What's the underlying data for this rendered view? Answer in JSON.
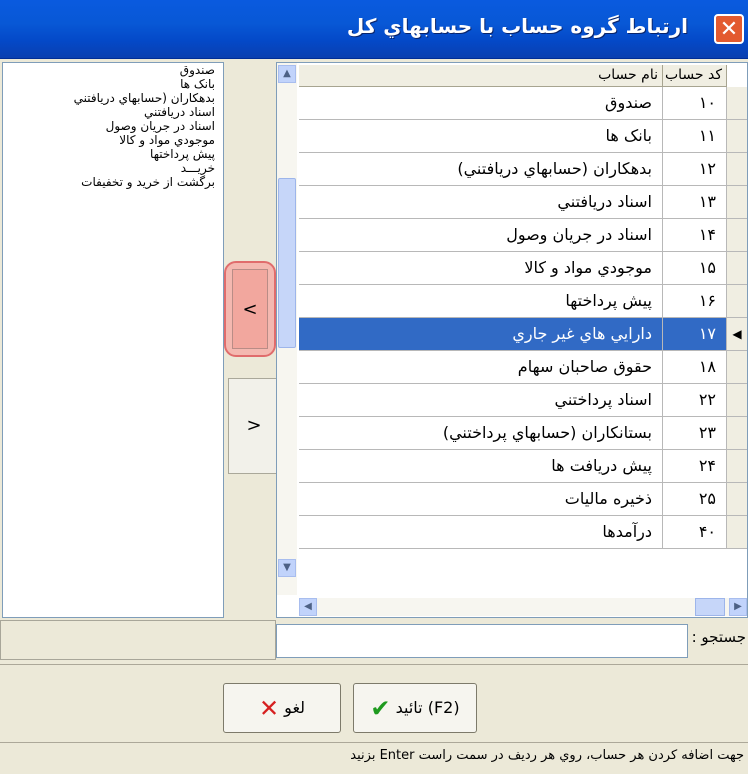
{
  "window": {
    "title": "ارتباط گروه حساب با حسابهاي کل",
    "close_glyph": "✕"
  },
  "left_list": {
    "items": [
      "صندوق",
      "بانک ها",
      "بدهکاران (حسابهاي دريافتني",
      "اسناد دريافتني",
      "اسناد در جريان وصول",
      "موجودي مواد و کالا",
      "پيش پرداختها",
      "خريـــد",
      "برگشت  از خريد و تخفيفات"
    ]
  },
  "move_buttons": {
    "add_label": "<",
    "remove_label": ">"
  },
  "grid": {
    "columns": {
      "code": "کد حساب",
      "name": "نام حساب"
    },
    "rows": [
      {
        "code": "۱۰",
        "name": "صندوق",
        "selected": false
      },
      {
        "code": "۱۱",
        "name": "بانک ها",
        "selected": false
      },
      {
        "code": "۱۲",
        "name": "بدهکاران (حسابهاي دريافتني)",
        "selected": false
      },
      {
        "code": "۱۳",
        "name": "اسناد دريافتني",
        "selected": false
      },
      {
        "code": "۱۴",
        "name": "اسناد در جريان وصول",
        "selected": false
      },
      {
        "code": "۱۵",
        "name": "موجودي مواد و کالا",
        "selected": false
      },
      {
        "code": "۱۶",
        "name": "پيش پرداختها",
        "selected": false
      },
      {
        "code": "۱۷",
        "name": "دارايي هاي غير جاري",
        "selected": true
      },
      {
        "code": "۱۸",
        "name": "حقوق صاحبان سهام",
        "selected": false
      },
      {
        "code": "۲۲",
        "name": "اسناد پرداختني",
        "selected": false
      },
      {
        "code": "۲۳",
        "name": "بستانکاران (حسابهاي پرداختني)",
        "selected": false
      },
      {
        "code": "۲۴",
        "name": "پيش دريافت ها",
        "selected": false
      },
      {
        "code": "۲۵",
        "name": "ذخيره ماليات",
        "selected": false
      },
      {
        "code": "۴۰",
        "name": "درآمدها",
        "selected": false
      }
    ],
    "current_row_marker": "◀"
  },
  "search": {
    "label": "جستجو :",
    "value": ""
  },
  "buttons": {
    "ok": "تائيد (F2)",
    "cancel": "لغو"
  },
  "status_text": "جهت اضافه كردن هر حساب، روي هر رديف در سمت راست Enter بزنيد",
  "colors": {
    "selection": "#316AC5",
    "title_bar": "#0858D6",
    "highlight_border": "#E06C6C"
  }
}
